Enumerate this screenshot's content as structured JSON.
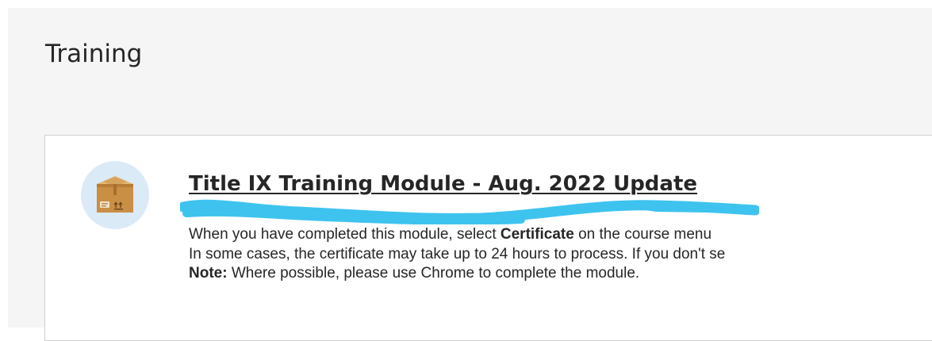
{
  "page": {
    "title": "Training"
  },
  "item": {
    "icon": "package-box-icon",
    "title": "Title IX Training Module - Aug. 2022 Update",
    "description": {
      "line1_prefix": "When you have completed this module, select ",
      "line1_bold": "Certificate",
      "line1_suffix": " on the course menu",
      "line2": "In some cases, the certificate may take up to 24 hours to process. If you don't se",
      "line3_bold": "Note:",
      "line3_suffix": " Where possible, please use Chrome to complete the module."
    }
  },
  "colors": {
    "page_background": "#f5f5f5",
    "card_background": "#ffffff",
    "card_border": "#cfcfcf",
    "icon_circle": "#dbeaf7",
    "scribble": "#3ec3ef",
    "text": "#262626"
  }
}
